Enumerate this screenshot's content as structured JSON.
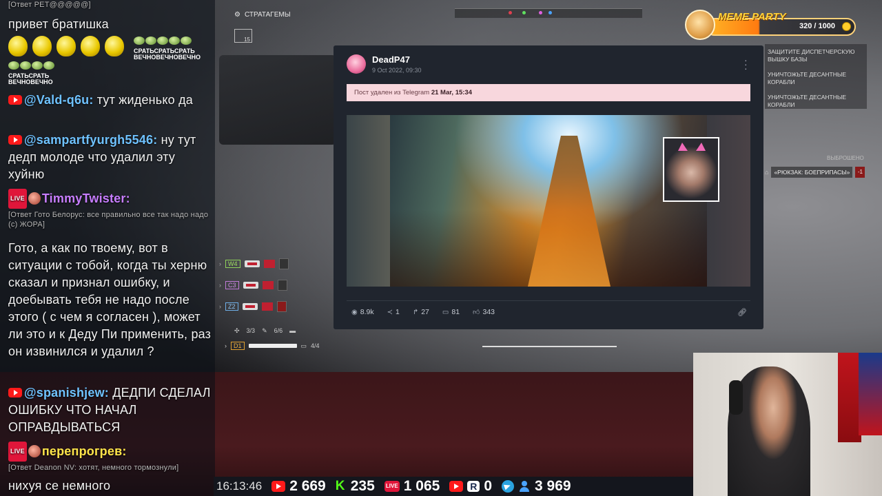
{
  "chat": {
    "header": "[Ответ PET@@@@@]",
    "messages": [
      {
        "type": "text",
        "text": "привет братишка"
      },
      {
        "type": "emotes",
        "captions": [
          "СРАТЬСРАТЬСРАТЬ ВЕЧНОВЕЧНОВЕЧНО",
          "СРАТЬСРАТЬ ВЕЧНОВЕЧНО"
        ]
      },
      {
        "type": "msg",
        "platform": "youtube",
        "user": "@Vald-q6u:",
        "text": "тут жиденько да",
        "color": "#6fc2ff"
      },
      {
        "type": "msg",
        "platform": "youtube",
        "user": "@sampartfyurgh5546:",
        "text": "ну тут дедп молоде что удалил эту хуйню",
        "color": "#6fc2ff"
      },
      {
        "type": "msg",
        "platform": "vk",
        "user": "TimmyTwister:",
        "text": "",
        "color": "#c77dff"
      },
      {
        "type": "reply",
        "text": "[Ответ Гото Белорус: все правильно все так надо надо (с) ЖОРА]"
      },
      {
        "type": "text",
        "text": "Гото, а как по твоему, вот в ситуации с тобой, когда ты херню сказал и признал ошибку, и доебывать тебя не надо после этого ( с чем я согласен ), может ли это и к Деду Пи применить, раз он извинился и удалил ?"
      },
      {
        "type": "msg",
        "platform": "youtube",
        "user": "@spanishjew:",
        "text": "ДЕДПИ СДЕЛАЛ ОШИБКУ ЧТО НАЧАЛ ОПРАВДЫВАТЬСЯ",
        "color": "#6fc2ff"
      },
      {
        "type": "msg",
        "platform": "vk",
        "user": "перепрогрев:",
        "text": "",
        "color": "#ffe54a"
      },
      {
        "type": "reply",
        "text": "[Ответ Deanon NV: хотят, немного тормознули]"
      },
      {
        "type": "text",
        "text": "нихуя се немного"
      }
    ],
    "yt_label": "▶",
    "live_label": "LIVE"
  },
  "bottom_bar": {
    "time": "16:13:46",
    "youtube": "2 669",
    "kick": "235",
    "kick_letter": "K",
    "vk_live": "1 065",
    "vk_live_label": "LIVE",
    "rutube": "0",
    "rutube_letter": "R",
    "viewers": "3 969"
  },
  "game_hud": {
    "stratagems_label": "СТРАТАГЕМЫ",
    "strat_count": "15",
    "objectives": [
      "ЗАЩИТИТЕ ДИСПЕТЧЕРСКУЮ ВЫШКУ БАЗЫ",
      "УНИЧТОЖЬТЕ ДЕСАНТНЫЕ КОРАБЛИ",
      "УНИЧТОЖЬТЕ ДЕСАНТНЫЕ КОРАБЛИ"
    ],
    "pickup_title": "ВЫБРОШЕНО",
    "pickup_text": "«РЮКЗАК: БОЕПРИПАСЫ»",
    "pickup_key": "-1",
    "loadout": [
      {
        "code": "W4",
        "status": "ready"
      },
      {
        "code": "C3",
        "status": "ready"
      },
      {
        "code": "Z2",
        "status": "cooldown"
      }
    ],
    "grenades": "3/3",
    "stims": "6/6",
    "primary_code": "D1",
    "mags": "4/4"
  },
  "meme_party": {
    "title": "MEME PARTY",
    "progress": "320 / 1000",
    "progress_value": 320,
    "progress_max": 1000
  },
  "post": {
    "author": "DeadP47",
    "date": "9 Oct 2022, 09:30",
    "deleted_prefix": "Пост удален из Telegram",
    "deleted_date": "21 Mar, 15:34",
    "stats": {
      "views": "8.9k",
      "shares": "1",
      "forwards": "27",
      "comments": "81",
      "likes": "343"
    },
    "icons": {
      "views": "eye-icon",
      "shares": "share-icon",
      "forwards": "forward-icon",
      "comments": "comments-icon",
      "likes": "thumbs-up-icon",
      "link": "link-icon",
      "menu": "kebab-menu-icon"
    }
  }
}
